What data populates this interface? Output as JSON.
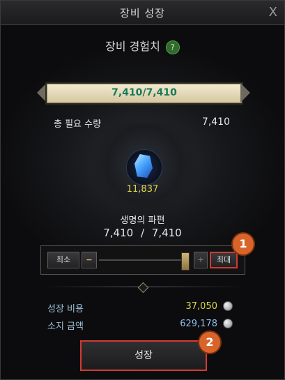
{
  "window": {
    "title": "장비 성장",
    "close_label": "X"
  },
  "header": {
    "subtitle": "장비 경험치",
    "help_label": "?"
  },
  "exp_bar": {
    "current": "7,410",
    "separator": "/",
    "max": "7,410",
    "fill_fraction": 1.0
  },
  "total_required": {
    "label": "총 필요 수량",
    "value": "7,410"
  },
  "material": {
    "icon": "crystal-icon",
    "count": "11,837",
    "name": "생명의 파편",
    "quantity": "7,410 / 7,410"
  },
  "controls": {
    "min_label": "최소",
    "minus_label": "−",
    "plus_label": "+",
    "max_label": "최대",
    "slider_fraction": 1.0
  },
  "markers": {
    "one": "1",
    "two": "2"
  },
  "cost": {
    "label": "성장 비용",
    "value": "37,050",
    "color": "#e0d44d"
  },
  "owned": {
    "label": "소지 금액",
    "value": "629,178",
    "color": "#8fbfe8"
  },
  "grow_button": {
    "label": "성장"
  },
  "colors": {
    "accent_red": "#d23a32",
    "marker": "#d9642a",
    "exp_text": "#1a7a5c"
  }
}
